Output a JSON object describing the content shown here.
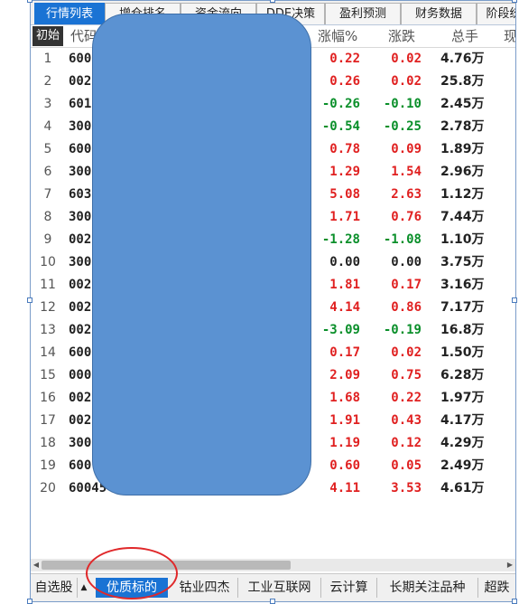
{
  "tabs": [
    "行情列表",
    "增仓排名",
    "资金流向",
    "DDE决策",
    "盈利预测",
    "财务数据",
    "阶段统"
  ],
  "active_tab": 0,
  "header": {
    "init_label": "初始",
    "code": "代码",
    "pct": "涨幅%",
    "chg": "涨跌",
    "vol": "总手",
    "extra": "现"
  },
  "rows": [
    {
      "idx": "1",
      "code": "600",
      "pct": "0.22",
      "chg": "0.02",
      "vol": "4.76万",
      "dir": "up"
    },
    {
      "idx": "2",
      "code": "002",
      "pct": "0.26",
      "chg": "0.02",
      "vol": "25.8万",
      "dir": "up"
    },
    {
      "idx": "3",
      "code": "601",
      "pct": "-0.26",
      "chg": "-0.10",
      "vol": "2.45万",
      "dir": "down"
    },
    {
      "idx": "4",
      "code": "300",
      "pct": "-0.54",
      "chg": "-0.25",
      "vol": "2.78万",
      "dir": "down"
    },
    {
      "idx": "5",
      "code": "600",
      "pct": "0.78",
      "chg": "0.09",
      "vol": "1.89万",
      "dir": "up"
    },
    {
      "idx": "6",
      "code": "300",
      "pct": "1.29",
      "chg": "1.54",
      "vol": "2.96万",
      "dir": "up"
    },
    {
      "idx": "7",
      "code": "603",
      "pct": "5.08",
      "chg": "2.63",
      "vol": "1.12万",
      "dir": "up"
    },
    {
      "idx": "8",
      "code": "300",
      "pct": "1.71",
      "chg": "0.76",
      "vol": "7.44万",
      "dir": "up"
    },
    {
      "idx": "9",
      "code": "002",
      "pct": "-1.28",
      "chg": "-1.08",
      "vol": "1.10万",
      "dir": "down"
    },
    {
      "idx": "10",
      "code": "300",
      "pct": "0.00",
      "chg": "0.00",
      "vol": "3.75万",
      "dir": "flat"
    },
    {
      "idx": "11",
      "code": "002",
      "pct": "1.81",
      "chg": "0.17",
      "vol": "3.16万",
      "dir": "up"
    },
    {
      "idx": "12",
      "code": "002",
      "pct": "4.14",
      "chg": "0.86",
      "vol": "7.17万",
      "dir": "up"
    },
    {
      "idx": "13",
      "code": "002",
      "pct": "-3.09",
      "chg": "-0.19",
      "vol": "16.8万",
      "dir": "down"
    },
    {
      "idx": "14",
      "code": "600",
      "pct": "0.17",
      "chg": "0.02",
      "vol": "1.50万",
      "dir": "up"
    },
    {
      "idx": "15",
      "code": "000",
      "pct": "2.09",
      "chg": "0.75",
      "vol": "6.28万",
      "dir": "up"
    },
    {
      "idx": "16",
      "code": "002",
      "pct": "1.68",
      "chg": "0.22",
      "vol": "1.97万",
      "dir": "up"
    },
    {
      "idx": "17",
      "code": "002",
      "pct": "1.91",
      "chg": "0.43",
      "vol": "4.17万",
      "dir": "up"
    },
    {
      "idx": "18",
      "code": "300",
      "pct": "1.19",
      "chg": "0.12",
      "vol": "4.29万",
      "dir": "up"
    },
    {
      "idx": "19",
      "code": "600",
      "pct": "0.60",
      "chg": "0.05",
      "vol": "2.49万",
      "dir": "up"
    },
    {
      "idx": "20",
      "code": "60045",
      "pct": "4.11",
      "chg": "3.53",
      "vol": "4.61万",
      "dir": "up"
    }
  ],
  "bottom_tabs": [
    "自选股",
    "优质标的",
    "钴业四杰",
    "工业互联网",
    "云计算",
    "长期关注品种",
    "超跌"
  ],
  "bottom_active": 1,
  "bottom_dropdown_icon": "triangle-up-icon",
  "colors": {
    "up": "#e02020",
    "down": "#0a8f2a",
    "accent": "#1a73d4",
    "mask": "#5b92d2",
    "annotation": "#e0282a"
  }
}
